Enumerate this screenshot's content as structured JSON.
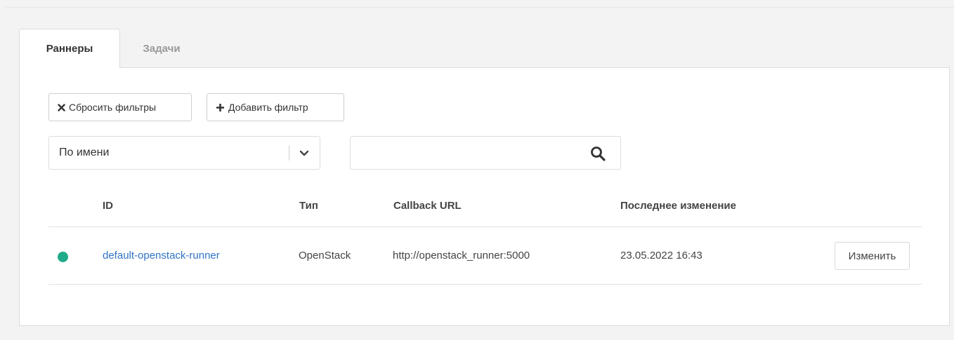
{
  "tabs": [
    {
      "label": "Раннеры",
      "active": true
    },
    {
      "label": "Задачи",
      "active": false
    }
  ],
  "filters": {
    "reset_label": "Сбросить фильтры",
    "reset_icon": "x-icon",
    "add_label": "Добавить фильтр",
    "add_icon": "plus-icon"
  },
  "select": {
    "value": "По имени",
    "icon": "chevron-down-icon"
  },
  "search": {
    "placeholder": "",
    "value": "",
    "icon": "search-icon"
  },
  "table": {
    "headers": {
      "id": "ID",
      "type": "Тип",
      "callback": "Callback URL",
      "modified": "Последнее изменение"
    },
    "rows": [
      {
        "status_color": "#1fab89",
        "id": "default-openstack-runner",
        "type": "OpenStack",
        "callback": "http://openstack_runner:5000",
        "modified": "23.05.2022 16:43",
        "action_label": "Изменить"
      }
    ]
  }
}
